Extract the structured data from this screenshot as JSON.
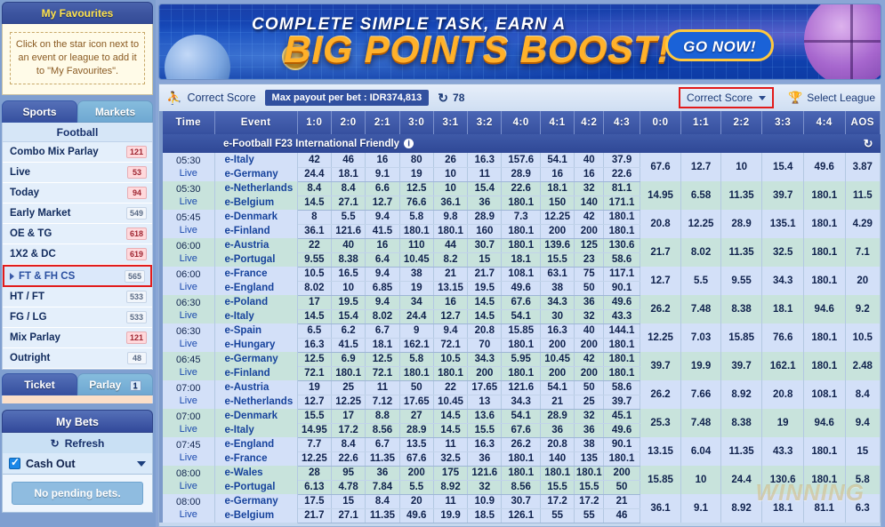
{
  "sidebar": {
    "favourites_title": "My Favourites",
    "favourites_note": "Click on the star icon next to an event or league to add it to \"My Favourites\".",
    "tab_sports": "Sports",
    "tab_markets": "Markets",
    "list_title": "Football",
    "items": [
      {
        "label": "Combo Mix Parlay",
        "count": "121",
        "style": "hot"
      },
      {
        "label": "Live",
        "count": "53",
        "style": "hot"
      },
      {
        "label": "Today",
        "count": "94",
        "style": "hot"
      },
      {
        "label": "Early Market",
        "count": "549",
        "style": "cold"
      },
      {
        "label": "OE & TG",
        "count": "618",
        "style": "hot"
      },
      {
        "label": "1X2 & DC",
        "count": "619",
        "style": "hot"
      },
      {
        "label": "FT & FH CS",
        "count": "565",
        "style": "cold",
        "selected": true
      },
      {
        "label": "HT / FT",
        "count": "533",
        "style": "cold"
      },
      {
        "label": "FG / LG",
        "count": "533",
        "style": "cold"
      },
      {
        "label": "Mix Parlay",
        "count": "121",
        "style": "hot"
      },
      {
        "label": "Outright",
        "count": "48",
        "style": "cold"
      }
    ],
    "tab_ticket": "Ticket",
    "tab_parlay": "Parlay",
    "parlay_count": "1",
    "mybets_title": "My Bets",
    "refresh_label": "Refresh",
    "cashout_label": "Cash Out",
    "no_pending": "No pending bets."
  },
  "banner": {
    "line1": "COMPLETE SIMPLE TASK, EARN A",
    "line2": "BIG POINTS BOOST!",
    "cta": "GO NOW!"
  },
  "toolbar": {
    "title": "Correct Score",
    "max_payout": "Max payout per bet : IDR374,813",
    "refresh_count": "78",
    "market_select": "Correct Score",
    "select_league": "Select League"
  },
  "table": {
    "headers": [
      "Time",
      "Event",
      "1:0",
      "2:0",
      "2:1",
      "3:0",
      "3:1",
      "3:2",
      "4:0",
      "4:1",
      "4:2",
      "4:3",
      "0:0",
      "1:1",
      "2:2",
      "3:3",
      "4:4",
      "AOS"
    ],
    "league": "e-Football F23 International Friendly",
    "live_label": "Live",
    "watermark": "WINNING",
    "rows": [
      {
        "time": "05:30",
        "home": "e-Italy",
        "away": "e-Germany",
        "home_odds": [
          "42",
          "46",
          "16",
          "80",
          "26",
          "16.3",
          "157.6",
          "54.1",
          "40",
          "37.9"
        ],
        "away_odds": [
          "24.4",
          "18.1",
          "9.1",
          "19",
          "10",
          "11",
          "28.9",
          "16",
          "16",
          "22.6"
        ],
        "draw_odds": [
          "67.6",
          "12.7",
          "10",
          "15.4",
          "49.6",
          "3.87"
        ]
      },
      {
        "time": "05:30",
        "home": "e-Netherlands",
        "away": "e-Belgium",
        "home_odds": [
          "8.4",
          "8.4",
          "6.6",
          "12.5",
          "10",
          "15.4",
          "22.6",
          "18.1",
          "32",
          "81.1"
        ],
        "away_odds": [
          "14.5",
          "27.1",
          "12.7",
          "76.6",
          "36.1",
          "36",
          "180.1",
          "150",
          "140",
          "171.1"
        ],
        "draw_odds": [
          "14.95",
          "6.58",
          "11.35",
          "39.7",
          "180.1",
          "11.5"
        ]
      },
      {
        "time": "05:45",
        "home": "e-Denmark",
        "away": "e-Finland",
        "home_odds": [
          "8",
          "5.5",
          "9.4",
          "5.8",
          "9.8",
          "28.9",
          "7.3",
          "12.25",
          "42",
          "180.1"
        ],
        "away_odds": [
          "36.1",
          "121.6",
          "41.5",
          "180.1",
          "180.1",
          "160",
          "180.1",
          "200",
          "200",
          "180.1"
        ],
        "draw_odds": [
          "20.8",
          "12.25",
          "28.9",
          "135.1",
          "180.1",
          "4.29"
        ]
      },
      {
        "time": "06:00",
        "home": "e-Austria",
        "away": "e-Portugal",
        "home_odds": [
          "22",
          "40",
          "16",
          "110",
          "44",
          "30.7",
          "180.1",
          "139.6",
          "125",
          "130.6"
        ],
        "away_odds": [
          "9.55",
          "8.38",
          "6.4",
          "10.45",
          "8.2",
          "15",
          "18.1",
          "15.5",
          "23",
          "58.6"
        ],
        "draw_odds": [
          "21.7",
          "8.02",
          "11.35",
          "32.5",
          "180.1",
          "7.1"
        ]
      },
      {
        "time": "06:00",
        "home": "e-France",
        "away": "e-England",
        "home_odds": [
          "10.5",
          "16.5",
          "9.4",
          "38",
          "21",
          "21.7",
          "108.1",
          "63.1",
          "75",
          "117.1"
        ],
        "away_odds": [
          "8.02",
          "10",
          "6.85",
          "19",
          "13.15",
          "19.5",
          "49.6",
          "38",
          "50",
          "90.1"
        ],
        "draw_odds": [
          "12.7",
          "5.5",
          "9.55",
          "34.3",
          "180.1",
          "20"
        ]
      },
      {
        "time": "06:30",
        "home": "e-Poland",
        "away": "e-Italy",
        "home_odds": [
          "17",
          "19.5",
          "9.4",
          "34",
          "16",
          "14.5",
          "67.6",
          "34.3",
          "36",
          "49.6"
        ],
        "away_odds": [
          "14.5",
          "15.4",
          "8.02",
          "24.4",
          "12.7",
          "14.5",
          "54.1",
          "30",
          "32",
          "43.3"
        ],
        "draw_odds": [
          "26.2",
          "7.48",
          "8.38",
          "18.1",
          "94.6",
          "9.2"
        ]
      },
      {
        "time": "06:30",
        "home": "e-Spain",
        "away": "e-Hungary",
        "home_odds": [
          "6.5",
          "6.2",
          "6.7",
          "9",
          "9.4",
          "20.8",
          "15.85",
          "16.3",
          "40",
          "144.1"
        ],
        "away_odds": [
          "16.3",
          "41.5",
          "18.1",
          "162.1",
          "72.1",
          "70",
          "180.1",
          "200",
          "200",
          "180.1"
        ],
        "draw_odds": [
          "12.25",
          "7.03",
          "15.85",
          "76.6",
          "180.1",
          "10.5"
        ]
      },
      {
        "time": "06:45",
        "home": "e-Germany",
        "away": "e-Finland",
        "home_odds": [
          "12.5",
          "6.9",
          "12.5",
          "5.8",
          "10.5",
          "34.3",
          "5.95",
          "10.45",
          "42",
          "180.1"
        ],
        "away_odds": [
          "72.1",
          "180.1",
          "72.1",
          "180.1",
          "180.1",
          "200",
          "180.1",
          "200",
          "200",
          "180.1"
        ],
        "draw_odds": [
          "39.7",
          "19.9",
          "39.7",
          "162.1",
          "180.1",
          "2.48"
        ]
      },
      {
        "time": "07:00",
        "home": "e-Austria",
        "away": "e-Netherlands",
        "home_odds": [
          "19",
          "25",
          "11",
          "50",
          "22",
          "17.65",
          "121.6",
          "54.1",
          "50",
          "58.6"
        ],
        "away_odds": [
          "12.7",
          "12.25",
          "7.12",
          "17.65",
          "10.45",
          "13",
          "34.3",
          "21",
          "25",
          "39.7"
        ],
        "draw_odds": [
          "26.2",
          "7.66",
          "8.92",
          "20.8",
          "108.1",
          "8.4"
        ]
      },
      {
        "time": "07:00",
        "home": "e-Denmark",
        "away": "e-Italy",
        "home_odds": [
          "15.5",
          "17",
          "8.8",
          "27",
          "14.5",
          "13.6",
          "54.1",
          "28.9",
          "32",
          "45.1"
        ],
        "away_odds": [
          "14.95",
          "17.2",
          "8.56",
          "28.9",
          "14.5",
          "15.5",
          "67.6",
          "36",
          "36",
          "49.6"
        ],
        "draw_odds": [
          "25.3",
          "7.48",
          "8.38",
          "19",
          "94.6",
          "9.4"
        ]
      },
      {
        "time": "07:45",
        "home": "e-England",
        "away": "e-France",
        "home_odds": [
          "7.7",
          "8.4",
          "6.7",
          "13.5",
          "11",
          "16.3",
          "26.2",
          "20.8",
          "38",
          "90.1"
        ],
        "away_odds": [
          "12.25",
          "22.6",
          "11.35",
          "67.6",
          "32.5",
          "36",
          "180.1",
          "140",
          "135",
          "180.1"
        ],
        "draw_odds": [
          "13.15",
          "6.04",
          "11.35",
          "43.3",
          "180.1",
          "15"
        ]
      },
      {
        "time": "08:00",
        "home": "e-Wales",
        "away": "e-Portugal",
        "home_odds": [
          "28",
          "95",
          "36",
          "200",
          "175",
          "121.6",
          "180.1",
          "180.1",
          "180.1",
          "200"
        ],
        "away_odds": [
          "6.13",
          "4.78",
          "7.84",
          "5.5",
          "8.92",
          "32",
          "8.56",
          "15.5",
          "15.5",
          "50"
        ],
        "draw_odds": [
          "15.85",
          "10",
          "24.4",
          "130.6",
          "180.1",
          "5.8"
        ]
      },
      {
        "time": "08:00",
        "home": "e-Germany",
        "away": "e-Belgium",
        "home_odds": [
          "17.5",
          "15",
          "8.4",
          "20",
          "11",
          "10.9",
          "30.7",
          "17.2",
          "17.2",
          "21"
        ],
        "away_odds": [
          "21.7",
          "27.1",
          "11.35",
          "49.6",
          "19.9",
          "18.5",
          "126.1",
          "55",
          "55",
          "46"
        ],
        "draw_odds": [
          "36.1",
          "9.1",
          "8.92",
          "18.1",
          "81.1",
          "6.3"
        ]
      }
    ]
  }
}
